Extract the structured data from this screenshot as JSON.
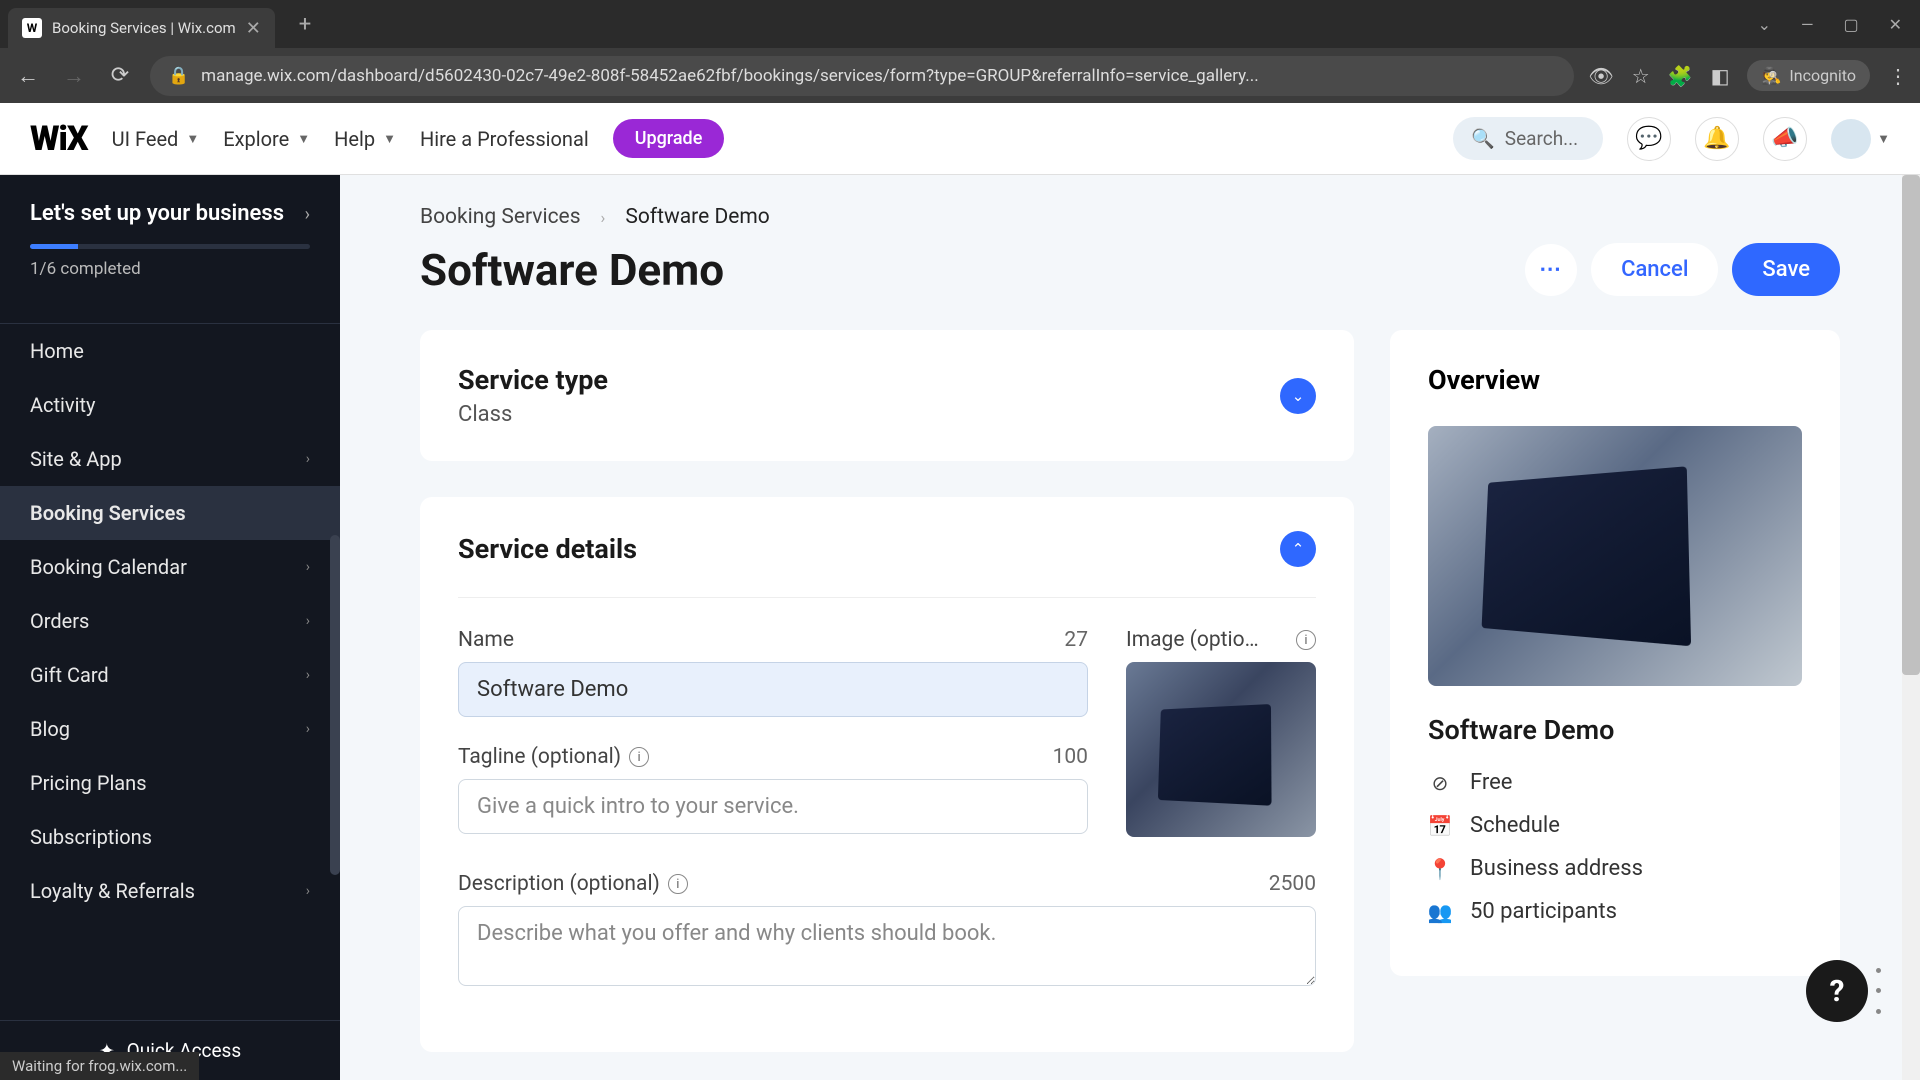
{
  "browser": {
    "tab_title": "Booking Services | Wix.com",
    "url": "manage.wix.com/dashboard/d5602430-02c7-49e2-808f-58452ae62fbf/bookings/services/form?type=GROUP&referralInfo=service_gallery...",
    "incognito_label": "Incognito",
    "status_text": "Waiting for frog.wix.com..."
  },
  "header": {
    "logo": "WiX",
    "items": [
      "UI Feed",
      "Explore",
      "Help",
      "Hire a Professional"
    ],
    "upgrade": "Upgrade",
    "search_placeholder": "Search..."
  },
  "sidebar": {
    "setup_title": "Let's set up your business",
    "progress_text": "1/6 completed",
    "items": [
      {
        "label": "Home",
        "chevron": false
      },
      {
        "label": "Activity",
        "chevron": false
      },
      {
        "label": "Site & App",
        "chevron": true
      },
      {
        "label": "Booking Services",
        "chevron": false,
        "active": true
      },
      {
        "label": "Booking Calendar",
        "chevron": true
      },
      {
        "label": "Orders",
        "chevron": true
      },
      {
        "label": "Gift Card",
        "chevron": true
      },
      {
        "label": "Blog",
        "chevron": true
      },
      {
        "label": "Pricing Plans",
        "chevron": false
      },
      {
        "label": "Subscriptions",
        "chevron": false
      },
      {
        "label": "Loyalty & Referrals",
        "chevron": true
      }
    ],
    "quick_access": "Quick Access"
  },
  "breadcrumb": {
    "parent": "Booking Services",
    "current": "Software Demo"
  },
  "page": {
    "title": "Software Demo",
    "cancel": "Cancel",
    "save": "Save"
  },
  "service_type": {
    "title": "Service type",
    "value": "Class"
  },
  "service_details": {
    "title": "Service details",
    "name_label": "Name",
    "name_count": "27",
    "name_value": "Software Demo",
    "image_label": "Image (optio…",
    "tagline_label": "Tagline (optional)",
    "tagline_count": "100",
    "tagline_placeholder": "Give a quick intro to your service.",
    "desc_label": "Description (optional)",
    "desc_count": "2500",
    "desc_placeholder": "Describe what you offer and why clients should book."
  },
  "overview": {
    "title": "Overview",
    "name": "Software Demo",
    "price": "Free",
    "schedule": "Schedule",
    "location": "Business address",
    "participants": "50 participants"
  }
}
